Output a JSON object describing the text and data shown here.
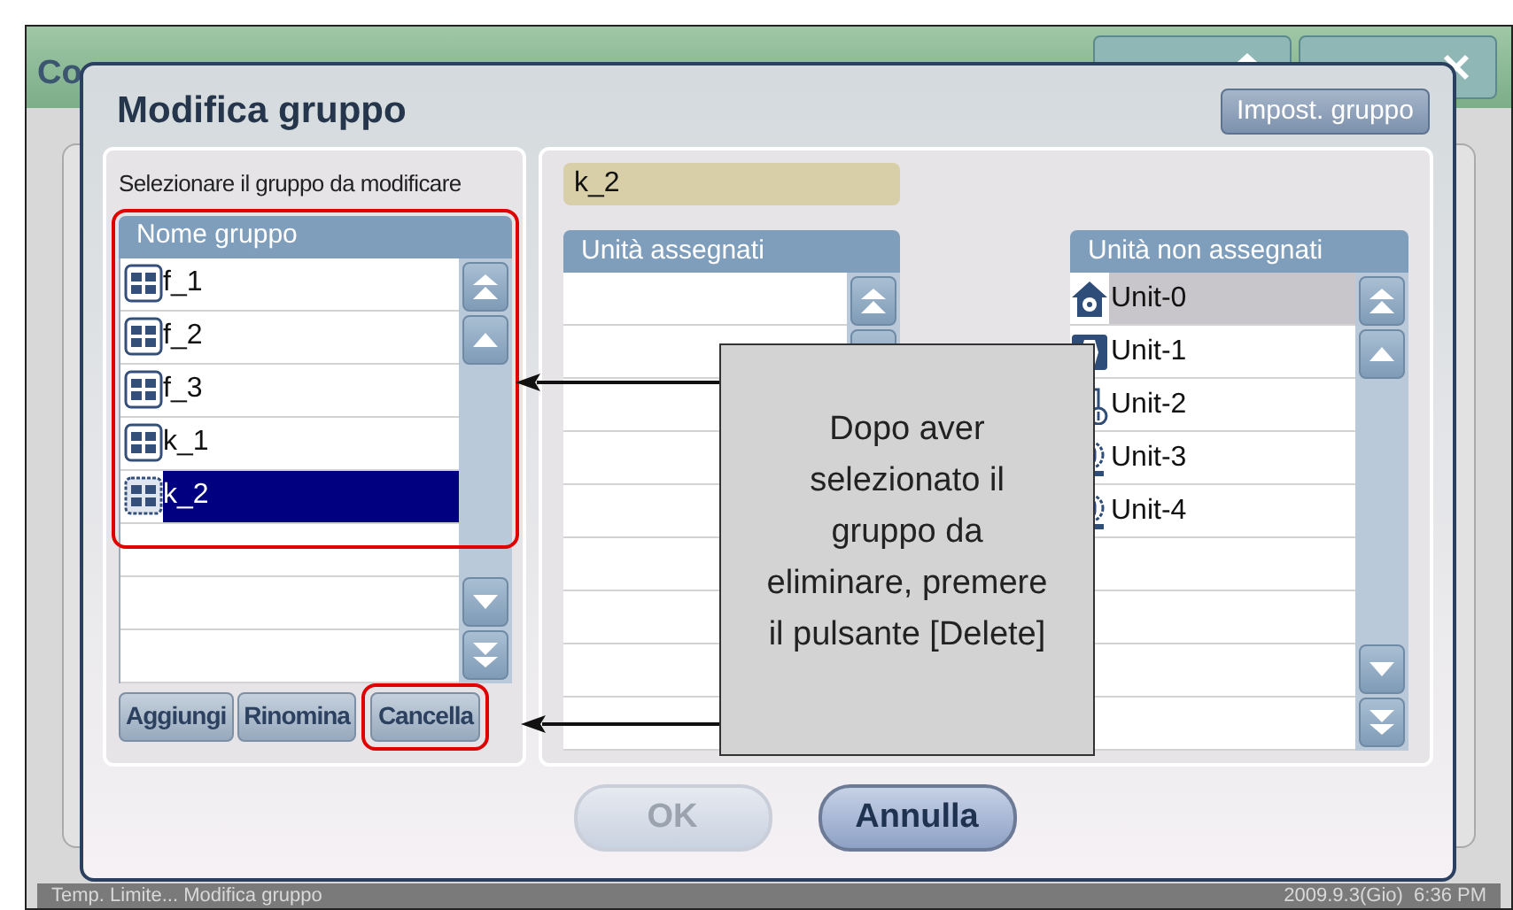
{
  "background_window": {
    "title": "Co",
    "buttons": [
      {
        "kind": "home"
      },
      {
        "kind": "exit"
      }
    ]
  },
  "dialog": {
    "title": "Modifica gruppo",
    "settings_button": "Impost. gruppo",
    "group_panel": {
      "prompt": "Selezionare il gruppo da modificare",
      "header": "Nome gruppo",
      "highlighted": true,
      "rows": [
        {
          "name": "f_1",
          "selected": false
        },
        {
          "name": "f_2",
          "selected": false
        },
        {
          "name": "f_3",
          "selected": false
        },
        {
          "name": "k_1",
          "selected": false
        },
        {
          "name": "k_2",
          "selected": true
        }
      ],
      "buttons": [
        {
          "label": "Aggiungi",
          "highlighted": false
        },
        {
          "label": "Rinomina",
          "highlighted": false
        },
        {
          "label": "Cancella",
          "highlighted": true
        }
      ]
    },
    "name_field": {
      "value": "k_2"
    },
    "assigned": {
      "header": "Unità assegnati"
    },
    "unassigned": {
      "header": "Unità non assegnati",
      "rows": [
        {
          "name": "Unit-0",
          "kind": "house",
          "selected": true
        },
        {
          "name": "Unit-1",
          "kind": "wall",
          "selected": false
        },
        {
          "name": "Unit-2",
          "kind": "duct",
          "selected": false
        },
        {
          "name": "Unit-3",
          "kind": "ahu",
          "selected": false
        },
        {
          "name": "Unit-4",
          "kind": "ahu",
          "selected": false
        }
      ]
    },
    "buttons": [
      {
        "label": "OK",
        "disabled": true
      },
      {
        "label": "Annulla",
        "disabled": false
      }
    ]
  },
  "callout": {
    "lines": [
      "Dopo aver",
      "selezionato il",
      "gruppo da",
      "eliminare, premere",
      "il pulsante [Delete]"
    ]
  },
  "status_bar": {
    "left": "Temp. Limite... Modifica gruppo",
    "right": "2009.9.3(Gio)  6:36 PM"
  }
}
